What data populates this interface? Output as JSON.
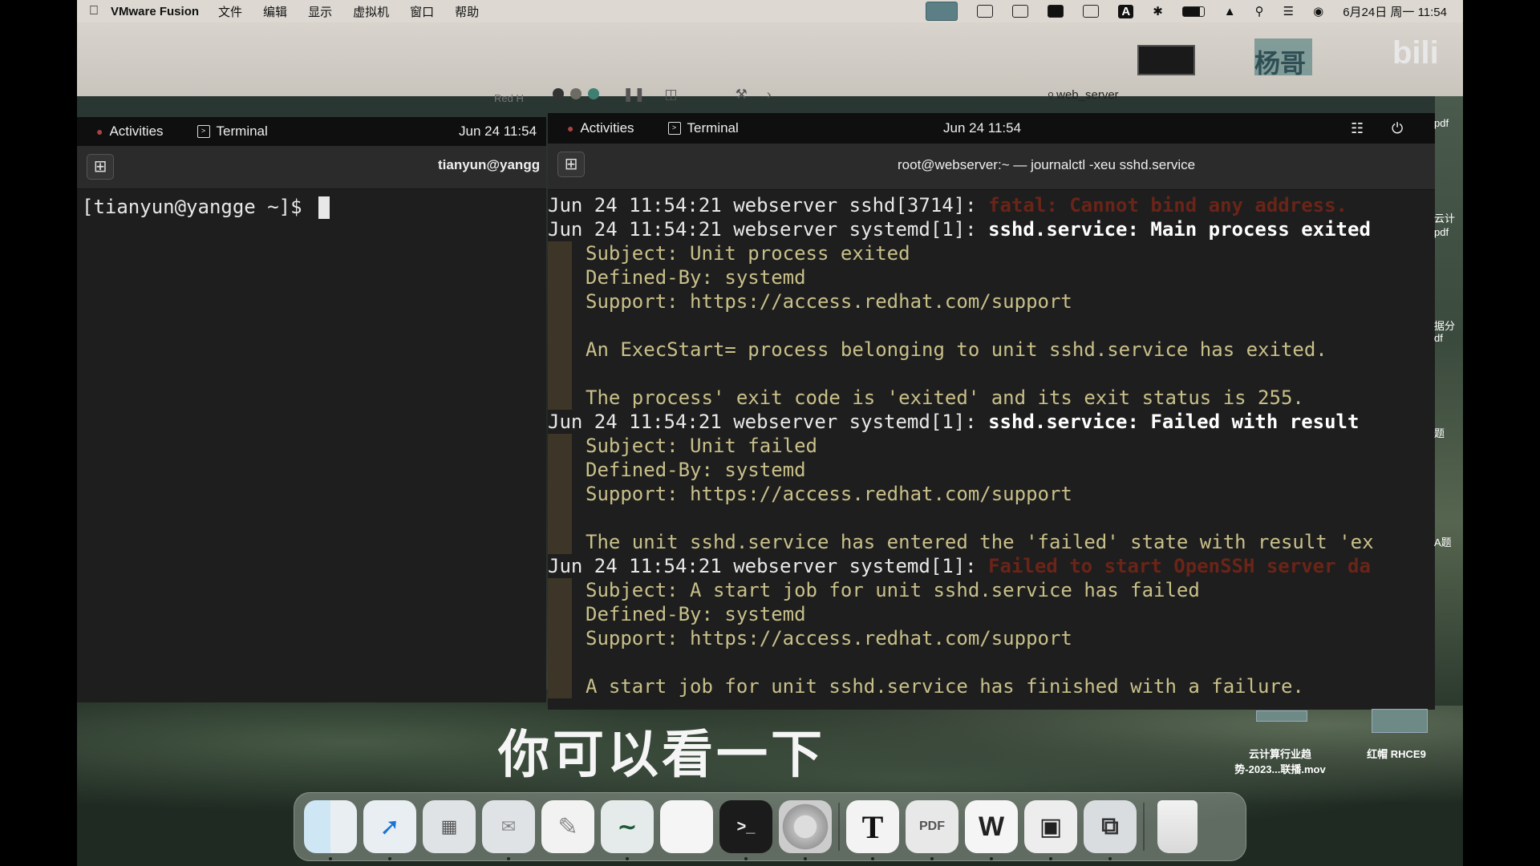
{
  "menubar": {
    "app_name": "VMware Fusion",
    "menus": [
      "文件",
      "编辑",
      "显示",
      "虚拟机",
      "窗口",
      "帮助"
    ],
    "status_icons": [
      "display-icon",
      "camera-icon",
      "window-icon",
      "wps-icon",
      "sync-icon",
      "input-a-icon",
      "bluetooth-icon",
      "battery-icon",
      "wifi-icon",
      "search-icon",
      "control-center-icon",
      "siri-icon"
    ],
    "input_label": "A",
    "datetime": "6月24日 周一 11:54"
  },
  "vmware": {
    "window_title": "web_server",
    "left_tab_hint": "Red H",
    "brand_text": "杨哥",
    "bilibili_logo": "bili",
    "accent_colors": {
      "active": "#5c7f86",
      "green": "#3f7f72"
    }
  },
  "left_vm": {
    "activities": "Activities",
    "terminal": "Terminal",
    "clock": "Jun 24  11:54",
    "header_title": "tianyun@yangg",
    "prompt": "[tianyun@yangge ~]$ "
  },
  "right_vm": {
    "activities": "Activities",
    "terminal": "Terminal",
    "clock": "Jun 24  11:54",
    "header_title": "root@webserver:~ — journalctl -xeu sshd.service",
    "log": [
      {
        "kind": "main",
        "prefix": "Jun 24 11:54:21 webserver sshd[3714]: ",
        "msg": "fatal: Cannot bind any address.",
        "style": "err"
      },
      {
        "kind": "main",
        "prefix": "Jun 24 11:54:21 webserver systemd[1]: ",
        "msg": "sshd.service: Main process exited",
        "style": "hl"
      },
      {
        "kind": "sub",
        "text": "Subject: Unit process exited"
      },
      {
        "kind": "sub",
        "text": "Defined-By: systemd"
      },
      {
        "kind": "sub",
        "text": "Support: https://access.redhat.com/support"
      },
      {
        "kind": "sub",
        "text": ""
      },
      {
        "kind": "sub",
        "text": "An ExecStart= process belonging to unit sshd.service has exited."
      },
      {
        "kind": "sub",
        "text": ""
      },
      {
        "kind": "sub",
        "text": "The process' exit code is 'exited' and its exit status is 255."
      },
      {
        "kind": "main",
        "prefix": "Jun 24 11:54:21 webserver systemd[1]: ",
        "msg": "sshd.service: Failed with result",
        "style": "hl"
      },
      {
        "kind": "sub",
        "text": "Subject: Unit failed"
      },
      {
        "kind": "sub",
        "text": "Defined-By: systemd"
      },
      {
        "kind": "sub",
        "text": "Support: https://access.redhat.com/support"
      },
      {
        "kind": "sub",
        "text": ""
      },
      {
        "kind": "sub",
        "text": "The unit sshd.service has entered the 'failed' state with result 'ex"
      },
      {
        "kind": "main",
        "prefix": "Jun 24 11:54:21 webserver systemd[1]: ",
        "msg": "Failed to start OpenSSH server da",
        "style": "err"
      },
      {
        "kind": "sub",
        "text": "Subject: A start job for unit sshd.service has failed"
      },
      {
        "kind": "sub",
        "text": "Defined-By: systemd"
      },
      {
        "kind": "sub",
        "text": "Support: https://access.redhat.com/support"
      },
      {
        "kind": "sub",
        "text": ""
      },
      {
        "kind": "sub",
        "text": "A start job for unit sshd.service has finished with a failure."
      }
    ]
  },
  "subtitle": "你可以看一下",
  "desktop": {
    "files": [
      {
        "label": "云计算行业趋\n势-2023...联播.mov"
      },
      {
        "label": "红帽 RHCE9"
      }
    ],
    "side_labels": [
      "云计",
      "pdf",
      "据分",
      "df",
      "题",
      "A题",
      "pdf"
    ]
  },
  "dock": {
    "apps": [
      "finder-icon",
      "safari-icon",
      "launchpad-icon",
      "messages-icon",
      "notes-icon",
      "freeform-icon",
      "blank-app-icon",
      "terminal-icon",
      "chrome-icon",
      "typora-icon",
      "pdf-icon",
      "wps-icon",
      "chatbot-icon",
      "vmware-icon",
      "trash-icon"
    ],
    "terminal_glyph": ">_",
    "typora_glyph": "T",
    "pdf_glyph": "PDF",
    "wps_glyph": "W"
  }
}
